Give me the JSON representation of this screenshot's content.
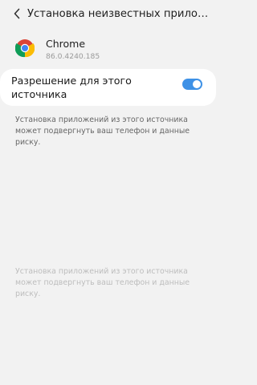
{
  "header": {
    "title": "Установка неизвестных приложен..."
  },
  "app": {
    "name": "Chrome",
    "version": "86.0.4240.185",
    "icon": "chrome-logo"
  },
  "permission": {
    "label": "Разрешение для этого источника",
    "enabled": true,
    "toggle_color": "#3e91e6"
  },
  "description_primary": "Установка приложений из этого источника может подвергнуть ваш телефон и данные риску.",
  "description_secondary": "Установка приложений из этого источника может подвергнуть ваш телефон и данные риску."
}
